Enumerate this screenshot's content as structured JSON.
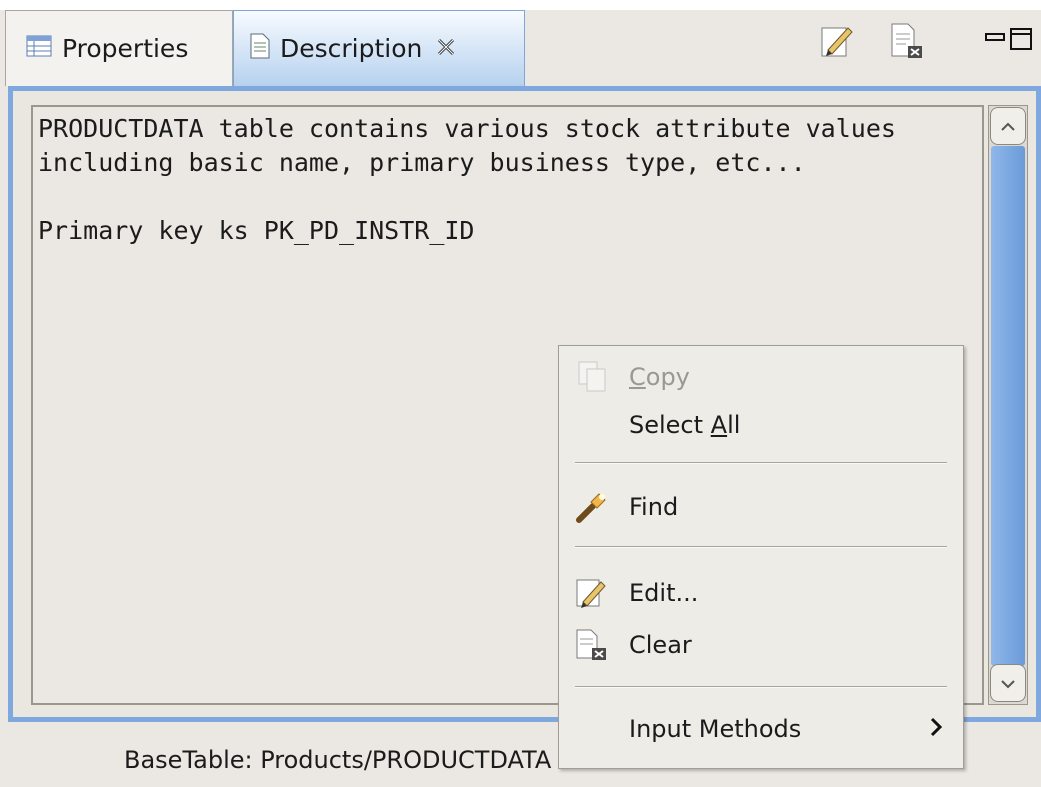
{
  "tabs": [
    {
      "label": "Properties",
      "icon": "properties-table-icon"
    },
    {
      "label": "Description",
      "icon": "document-icon",
      "close_icon": "close-x-icon",
      "active": true
    }
  ],
  "toolbar": {
    "edit_icon": "edit-pencil-icon",
    "clear_icon": "clear-document-icon",
    "minimize_icon": "minimize-icon",
    "maximize_icon": "maximize-icon"
  },
  "description": {
    "text": "PRODUCTDATA table contains various stock attribute values\nincluding basic name, primary business type, etc...\n\nPrimary key ks PK_PD_INSTR_ID"
  },
  "footer": {
    "label": "BaseTable: Products/PRODUCTDATA"
  },
  "context_menu": {
    "copy": {
      "label": "Copy",
      "enabled": false,
      "icon": "copy-icon"
    },
    "select_all": {
      "label": "Select All"
    },
    "find": {
      "label": "Find",
      "icon": "find-flashlight-icon"
    },
    "edit": {
      "label": "Edit...",
      "icon": "edit-pencil-icon"
    },
    "clear": {
      "label": "Clear",
      "icon": "clear-document-icon"
    },
    "input_methods": {
      "label": "Input Methods",
      "submenu_icon": "chevron-right-icon"
    }
  },
  "colors": {
    "active_tab": "#b6d1ef",
    "panel_border": "#7fa9de",
    "scroll_thumb": "#6a9ad8"
  }
}
